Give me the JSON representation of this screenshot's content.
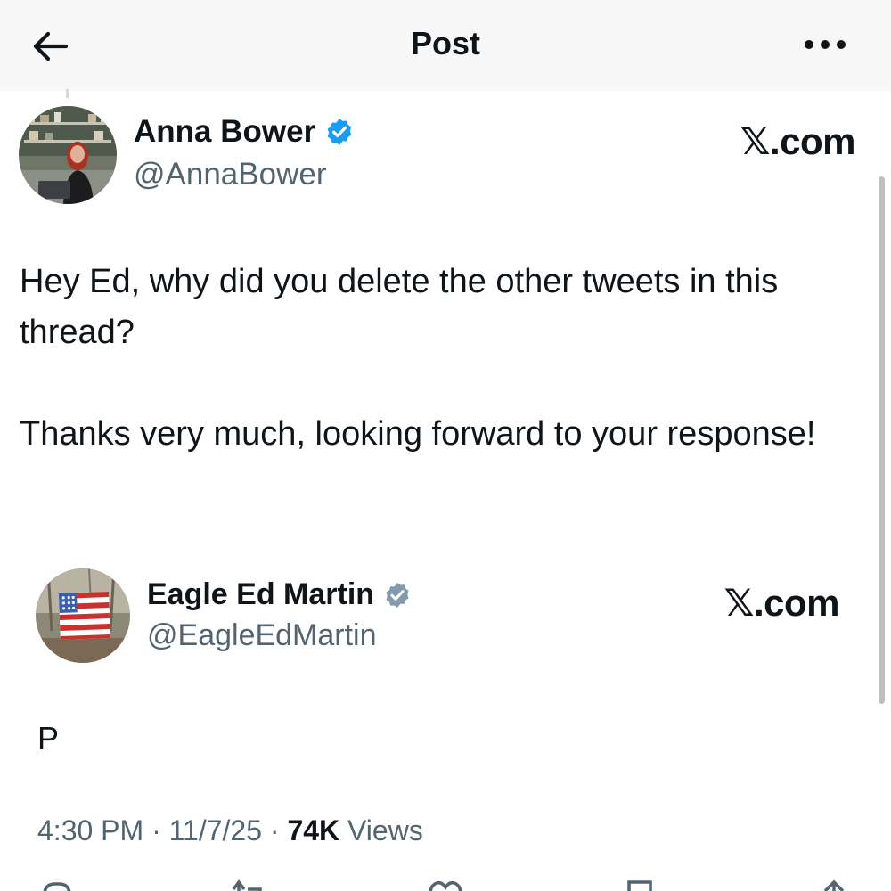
{
  "header": {
    "title": "Post",
    "back_icon": "arrow-left-icon",
    "more_icon": "more-horizontal-icon"
  },
  "post": {
    "author_name": "Anna Bower",
    "author_handle": "@AnnaBower",
    "verified_color": "#1d9bf0",
    "watermark": "𝕏.com",
    "body_paragraphs": [
      "Hey Ed, why did you delete the other tweets in this thread?",
      "Thanks very much, looking forward to your response!"
    ]
  },
  "quoted": {
    "author_name": "Eagle Ed Martin",
    "author_handle": "@EagleEdMartin",
    "verified_color": "#829aab",
    "watermark": "𝕏.com",
    "text": "P"
  },
  "meta": {
    "time": "4:30 PM",
    "date": "11/7/25",
    "views_count": "74K",
    "views_label": "Views"
  },
  "actions": [
    {
      "icon": "reply-icon"
    },
    {
      "icon": "repost-icon"
    },
    {
      "icon": "like-icon"
    },
    {
      "icon": "bookmark-icon"
    },
    {
      "icon": "share-icon"
    }
  ],
  "colors": {
    "text": "#0f1419",
    "secondary": "#536471",
    "topbar_bg": "#f7f7f7"
  }
}
